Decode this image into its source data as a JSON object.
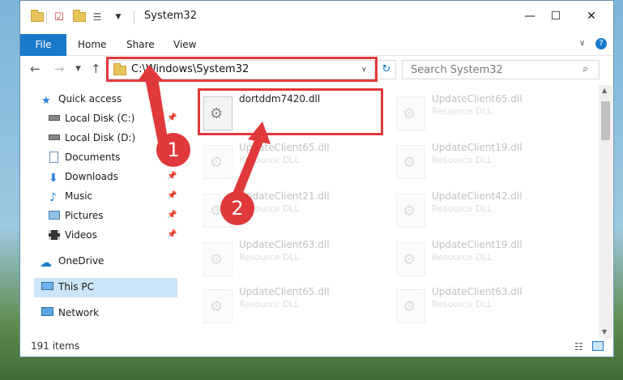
{
  "window": {
    "title": "System32",
    "controls": {
      "minimize": "—",
      "maximize": "☐",
      "close": "✕"
    }
  },
  "ribbon": {
    "tabs": [
      "File",
      "Home",
      "Share",
      "View"
    ]
  },
  "navbar": {
    "address": "C:\\Windows\\System32",
    "search_placeholder": "Search System32"
  },
  "sidebar": {
    "items": [
      {
        "label": "Quick access",
        "icon": "star-icon"
      },
      {
        "label": "Local Disk (C:)",
        "icon": "drive-icon",
        "pinned": true
      },
      {
        "label": "Local Disk (D:)",
        "icon": "drive-icon",
        "pinned": false
      },
      {
        "label": "Documents",
        "icon": "documents-icon",
        "pinned": true
      },
      {
        "label": "Downloads",
        "icon": "downloads-icon",
        "pinned": true
      },
      {
        "label": "Music",
        "icon": "music-icon",
        "pinned": true
      },
      {
        "label": "Pictures",
        "icon": "pictures-icon",
        "pinned": true
      },
      {
        "label": "Videos",
        "icon": "videos-icon",
        "pinned": true
      },
      {
        "label": "OneDrive",
        "icon": "onedrive-icon"
      },
      {
        "label": "This PC",
        "icon": "pc-icon",
        "selected": true
      },
      {
        "label": "Network",
        "icon": "network-icon"
      }
    ]
  },
  "files": {
    "highlighted": {
      "name": "dortddm7420.dll",
      "type": ""
    },
    "col1": [
      {
        "name": "UpdateClient65.dll",
        "type": "Resource DLL"
      },
      {
        "name": "UpdateClient21.dll",
        "type": "Resource DLL"
      },
      {
        "name": "UpdateClient63.dll",
        "type": "Resource DLL"
      },
      {
        "name": "UpdateClient65.dll",
        "type": "Resource DLL"
      }
    ],
    "col2": [
      {
        "name": "UpdateClient65.dll",
        "type": "Resource DLL"
      },
      {
        "name": "UpdateClient19.dll",
        "type": "Resource DLL"
      },
      {
        "name": "UpdateClient42.dll",
        "type": "Resource DLL"
      },
      {
        "name": "UpdateClient19.dll",
        "type": "Resource DLL"
      },
      {
        "name": "UpdateClient63.dll",
        "type": "Resource DLL"
      }
    ]
  },
  "status": {
    "items": "191 items"
  },
  "annotations": {
    "step1": "1",
    "step2": "2",
    "color": "#e0393b"
  }
}
